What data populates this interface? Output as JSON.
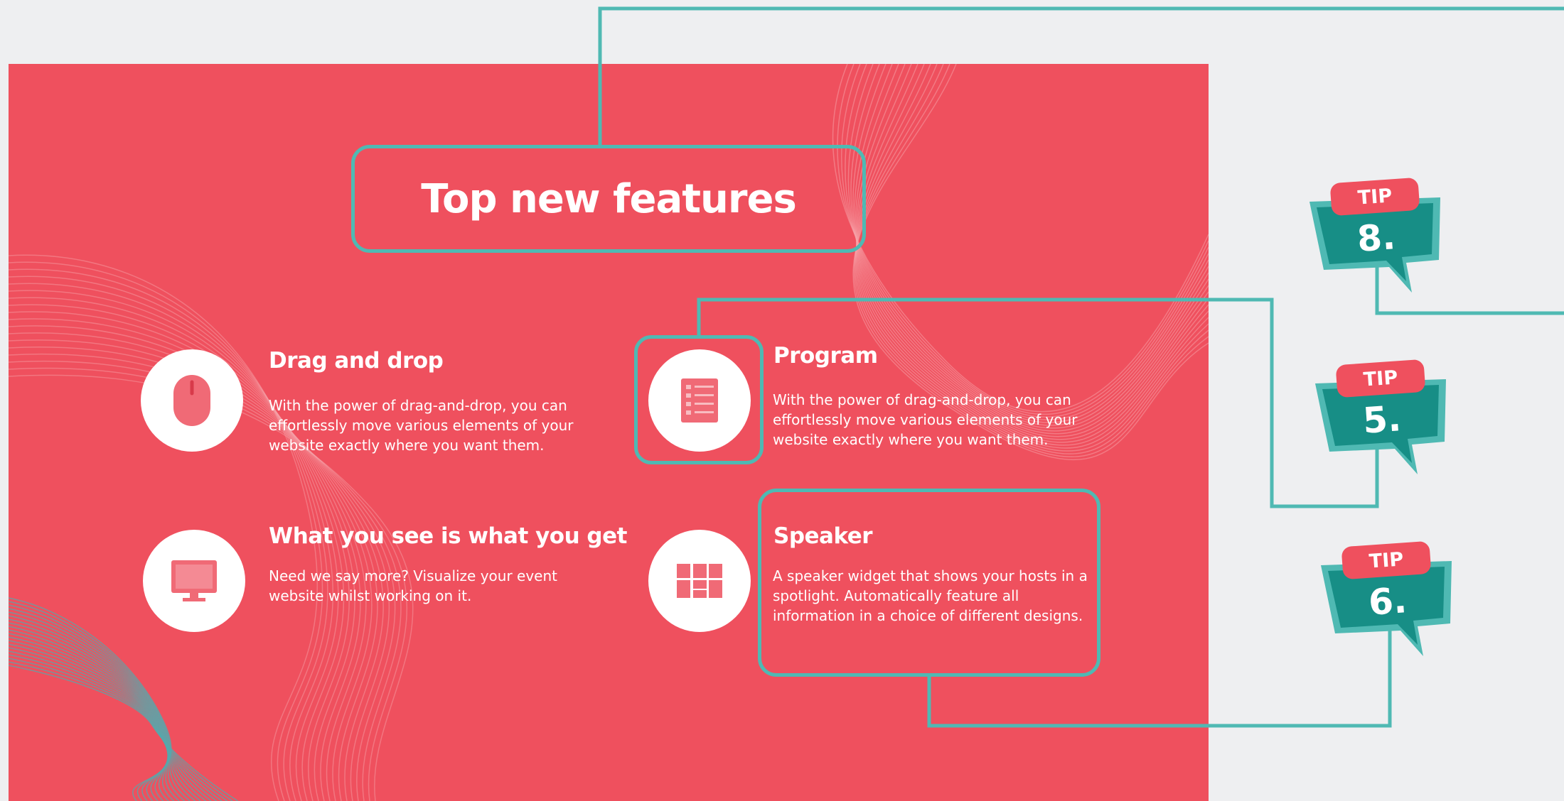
{
  "slide": {
    "title": "Top new features",
    "features": [
      {
        "title": "Drag and drop",
        "description": "With the power of drag-and-drop, you can effortlessly move various elements of your website exactly where you want them.",
        "icon": "mouse-icon"
      },
      {
        "title": "Program",
        "description": "With the power of drag-and-drop, you can effortlessly move various elements of your website exactly where you want them.",
        "icon": "list-document-icon"
      },
      {
        "title": "What you see is what you get",
        "description": "Need we say more? Visualize your event website whilst working on it.",
        "icon": "monitor-icon"
      },
      {
        "title": "Speaker",
        "description": "A speaker widget that shows your hosts in a spotlight. Automatically feature all information in a choice of different designs.",
        "icon": "grid-layout-icon"
      }
    ]
  },
  "tips": [
    {
      "label": "TIP",
      "number": "8."
    },
    {
      "label": "TIP",
      "number": "5."
    },
    {
      "label": "TIP",
      "number": "6."
    }
  ],
  "colors": {
    "slide_background": "#ef505e",
    "canvas_background": "#eeeff1",
    "connector": "#4fb9b3",
    "tip_body": "#178e86",
    "text": "#ffffff"
  }
}
